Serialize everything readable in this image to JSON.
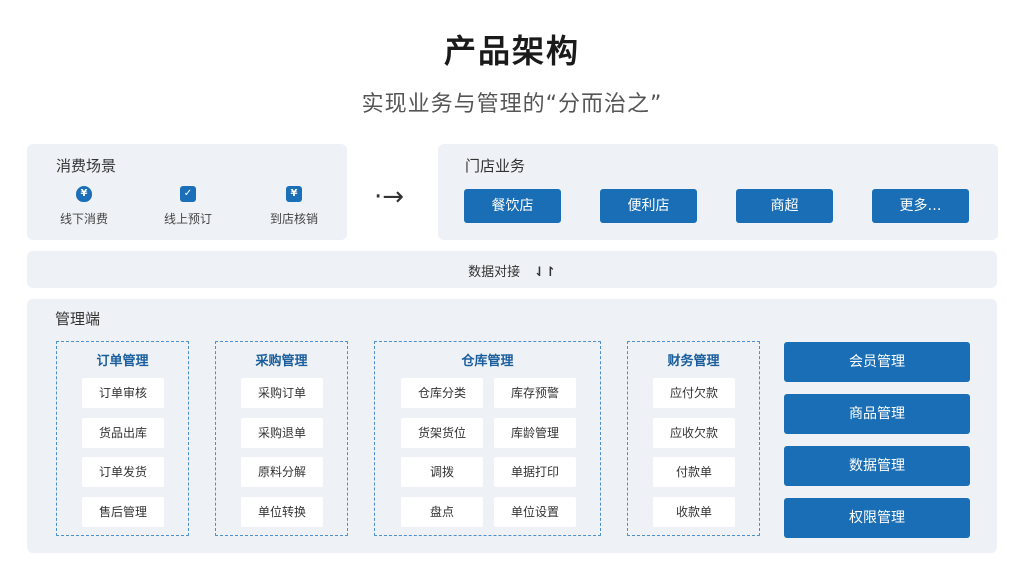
{
  "header": {
    "title": "产品架构",
    "subtitle": "实现业务与管理的“分而治之”"
  },
  "consumer_scene": {
    "title": "消费场景",
    "items": [
      {
        "label": "线下消费",
        "icon": "money-bag-icon"
      },
      {
        "label": "线上预订",
        "icon": "calendar-check-icon"
      },
      {
        "label": "到店核销",
        "icon": "ticket-yen-icon"
      }
    ]
  },
  "store_business": {
    "title": "门店业务",
    "buttons": [
      "餐饮店",
      "便利店",
      "商超",
      "更多…"
    ]
  },
  "data_link": {
    "label": "数据对接",
    "icon": "swap-vertical-icon"
  },
  "management": {
    "title": "管理端",
    "groups": [
      {
        "title": "订单管理",
        "cells": [
          "订单审核",
          "货品出库",
          "订单发货",
          "售后管理"
        ]
      },
      {
        "title": "采购管理",
        "cells": [
          "采购订单",
          "采购退单",
          "原料分解",
          "单位转换"
        ]
      },
      {
        "title": "仓库管理",
        "cells": [
          "仓库分类",
          "库存预警",
          "货架货位",
          "库龄管理",
          "调拨",
          "单据打印",
          "盘点",
          "单位设置"
        ]
      },
      {
        "title": "财务管理",
        "cells": [
          "应付欠款",
          "应收欠款",
          "付款单",
          "收款单"
        ]
      }
    ],
    "side_buttons": [
      "会员管理",
      "商品管理",
      "数据管理",
      "权限管理"
    ]
  },
  "colors": {
    "accent": "#1a6eb5",
    "panel_bg": "#eef2f6",
    "group_border": "#4d8fcc"
  }
}
